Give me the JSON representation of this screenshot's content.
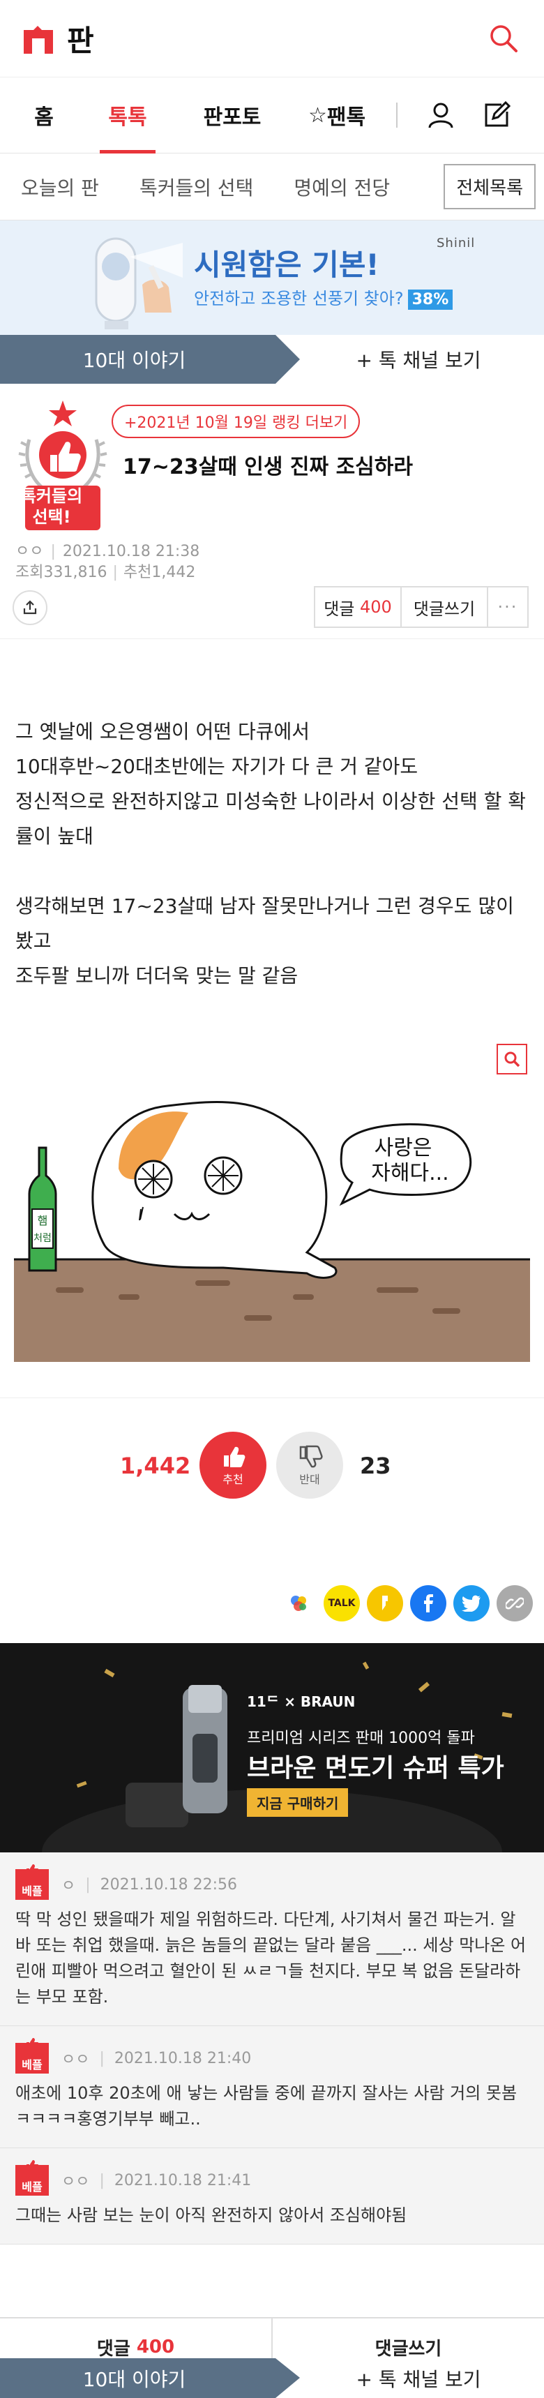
{
  "app": {
    "logo_text": "판"
  },
  "mainnav": {
    "home": "홈",
    "toktok": "톡톡",
    "panfoto": "판포토",
    "pantok": "팬톡",
    "star": "☆"
  },
  "subnav": {
    "today": "오늘의 판",
    "talkers": "톡커들의 선택",
    "fame": "명예의 전당",
    "all": "전체목록"
  },
  "ad_top": {
    "headline": "시원함은 기본!",
    "sub": "안전하고 조용한 선풍기 찾아?",
    "pct": "38%",
    "brand": "Shinil"
  },
  "channel": {
    "name": "10대 이야기",
    "more": "+ 톡 채널 보기"
  },
  "post": {
    "rank_link": "+2021년 10월 19일 랭킹 더보기",
    "badge": [
      "톡커들의",
      "선택!"
    ],
    "title": "17~23살때 인생 진짜 조심하라",
    "author": "ㅇㅇ",
    "date": "2021.10.18 21:38",
    "views_label": "조회",
    "views": "331,816",
    "recs_label": "추천",
    "recs": "1,442",
    "body": [
      "그 옛날에 오은영쌤이 어떤 다큐에서",
      "10대후반~20대초반에는 자기가 다 큰 거 같아도",
      "정신적으로 완전하지않고 미성숙한 나이라서 이상한 선택 할 확률이 높대",
      "",
      "생각해보면 17~23살때 남자 잘못만나거나 그런 경우도 많이 봤고",
      "조두팔 보니까 더더욱 맞는 말 같음"
    ],
    "illus_speech": [
      "사랑은",
      "자해다..."
    ],
    "illus_bottle": [
      "햄",
      "처럼"
    ]
  },
  "actions": {
    "comment_label": "댓글",
    "comment_count": "400",
    "write": "댓글쓰기",
    "more": "···"
  },
  "vote": {
    "up_count": "1,442",
    "up_label": "추천",
    "down_count": "23",
    "down_label": "반대"
  },
  "share": {
    "talk": "TALK"
  },
  "ad_bottom": {
    "brand": "11ᄃ × BRAUN",
    "line1": "프리미엄 시리즈 판매 1000억 돌파",
    "line2": "브라운 면도기 슈퍼 특가",
    "button": "지금 구매하기"
  },
  "comments": [
    {
      "best": "베플",
      "user": "ㅇ",
      "date": "2021.10.18 22:56",
      "text": "딱 막 성인 됐을때가 제일 위험하드라. 다단계, 사기쳐서 물건 파는거. 알바 또는 취업 했을때. 늙은 놈들의 끝없는 달라 붙음 ___... 세상 막나온 어린애 피빨아 먹으려고 혈안이 된 ㅆㄹㄱ들 천지다. 부모 복 없음 돈달라하는 부모 포함."
    },
    {
      "best": "베플",
      "user": "ㅇㅇ",
      "date": "2021.10.18 21:40",
      "text": "애초에 10후 20초에 애 낳는 사람들 중에 끝까지 잘사는 사람 거의 못봄ㅋㅋㅋㅋ홍영기부부 빼고.."
    },
    {
      "best": "베플",
      "user": "ㅇㅇ",
      "date": "2021.10.18 21:41",
      "text": "그때는 사람 보는 눈이 아직 완전하지 않아서 조심해야됨"
    }
  ],
  "colors": {
    "accent": "#e8343a",
    "channel": "#5a7086"
  }
}
